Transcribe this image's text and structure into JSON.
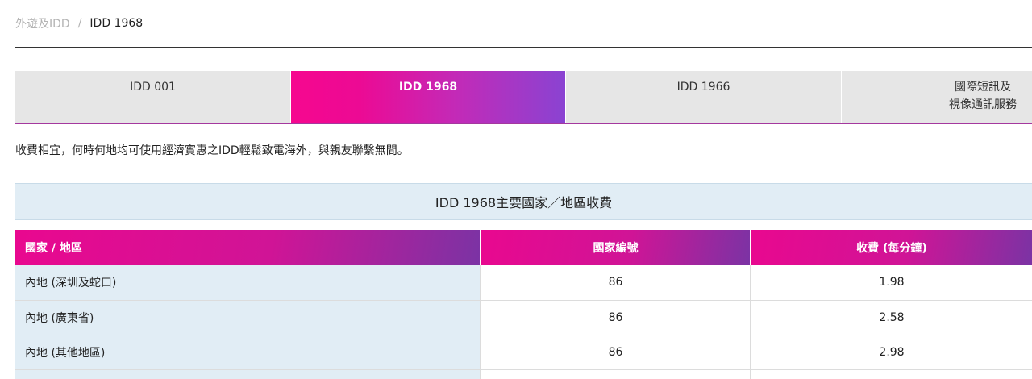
{
  "breadcrumb": {
    "parent": "外遊及IDD",
    "separator": "/",
    "current": "IDD 1968"
  },
  "tabs": [
    {
      "label": "IDD 001",
      "active": false
    },
    {
      "label": "IDD 1968",
      "active": true
    },
    {
      "label": "IDD 1966",
      "active": false
    },
    {
      "label": "國際短訊及\n視像通訊服務",
      "active": false
    }
  ],
  "intro_text": "收費相宜，何時何地均可使用經濟實惠之IDD輕鬆致電海外，與親友聯繫無間。",
  "rates": {
    "title": "IDD 1968主要國家／地區收費",
    "headers": [
      "國家 / 地區",
      "國家編號",
      "收費 (每分鐘)"
    ],
    "rows": [
      {
        "region": "內地 (深圳及蛇口)",
        "code": "86",
        "rate": "1.98"
      },
      {
        "region": "內地 (廣東省)",
        "code": "86",
        "rate": "2.58"
      },
      {
        "region": "內地 (其他地區)",
        "code": "86",
        "rate": "2.98"
      }
    ]
  },
  "colors": {
    "accent_pink": "#f6078f",
    "accent_purple": "#8a43d2",
    "region_cell_bg": "#e1edf5",
    "tab_inactive_bg": "#e6e6e6"
  }
}
